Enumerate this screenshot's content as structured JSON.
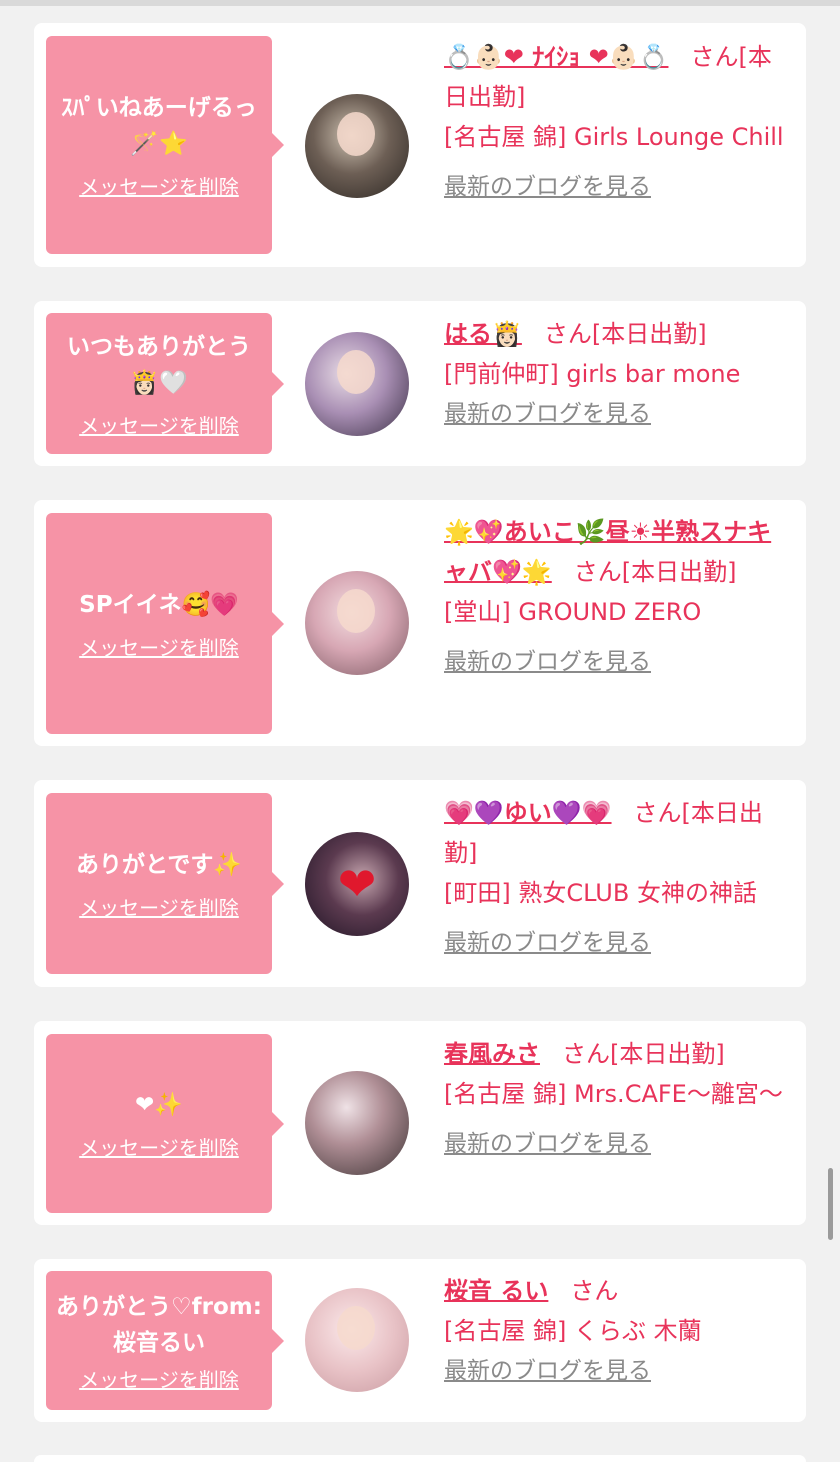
{
  "messages": [
    {
      "bubble": "ｽﾊﾟいねあーげるっ🪄⭐",
      "delete": "メッセージを削除",
      "name": "💍👶🏻❤ ﾅｲｼｮ ❤👶🏻💍",
      "san": "さん[本日出勤]",
      "shop": "[名古屋 錦] Girls Lounge Chill",
      "blog": "最新のブログを見る"
    },
    {
      "bubble": "いつもありがとう👸🏻🤍",
      "delete": "メッセージを削除",
      "name": "はる👸🏻",
      "san": "さん[本日出勤]",
      "shop": "[門前仲町] girls bar mone",
      "blog": "最新のブログを見る"
    },
    {
      "bubble": "SPイイネ🥰💗",
      "delete": "メッセージを削除",
      "name": "🌟💖あいこ🌿昼☀半熟スナキャバ💖🌟",
      "san": "さん[本日出勤]",
      "shop": "[堂山] GROUND ZERO",
      "blog": "最新のブログを見る"
    },
    {
      "bubble": "ありがとです✨",
      "delete": "メッセージを削除",
      "name": "💗💜ゆい💜💗",
      "san": "さん[本日出勤]",
      "shop": "[町田] 熟女CLUB 女神の神話",
      "blog": "最新のブログを見る"
    },
    {
      "bubble": "❤✨",
      "delete": "メッセージを削除",
      "name": "春風みさ",
      "san": "さん[本日出勤]",
      "shop": "[名古屋 錦] Mrs.CAFE〜離宮〜",
      "blog": "最新のブログを見る"
    },
    {
      "bubble": "ありがとう♡from:桜音るい",
      "delete": "メッセージを削除",
      "name": "桜音 るい",
      "san": "さん",
      "shop": "[名古屋 錦] くらぶ 木蘭",
      "blog": "最新のブログを見る"
    }
  ],
  "colors": {
    "bubble": "#f693a6",
    "accent": "#e8335a",
    "link_gray": "#8a8a8a",
    "background": "#f1f1f1"
  }
}
